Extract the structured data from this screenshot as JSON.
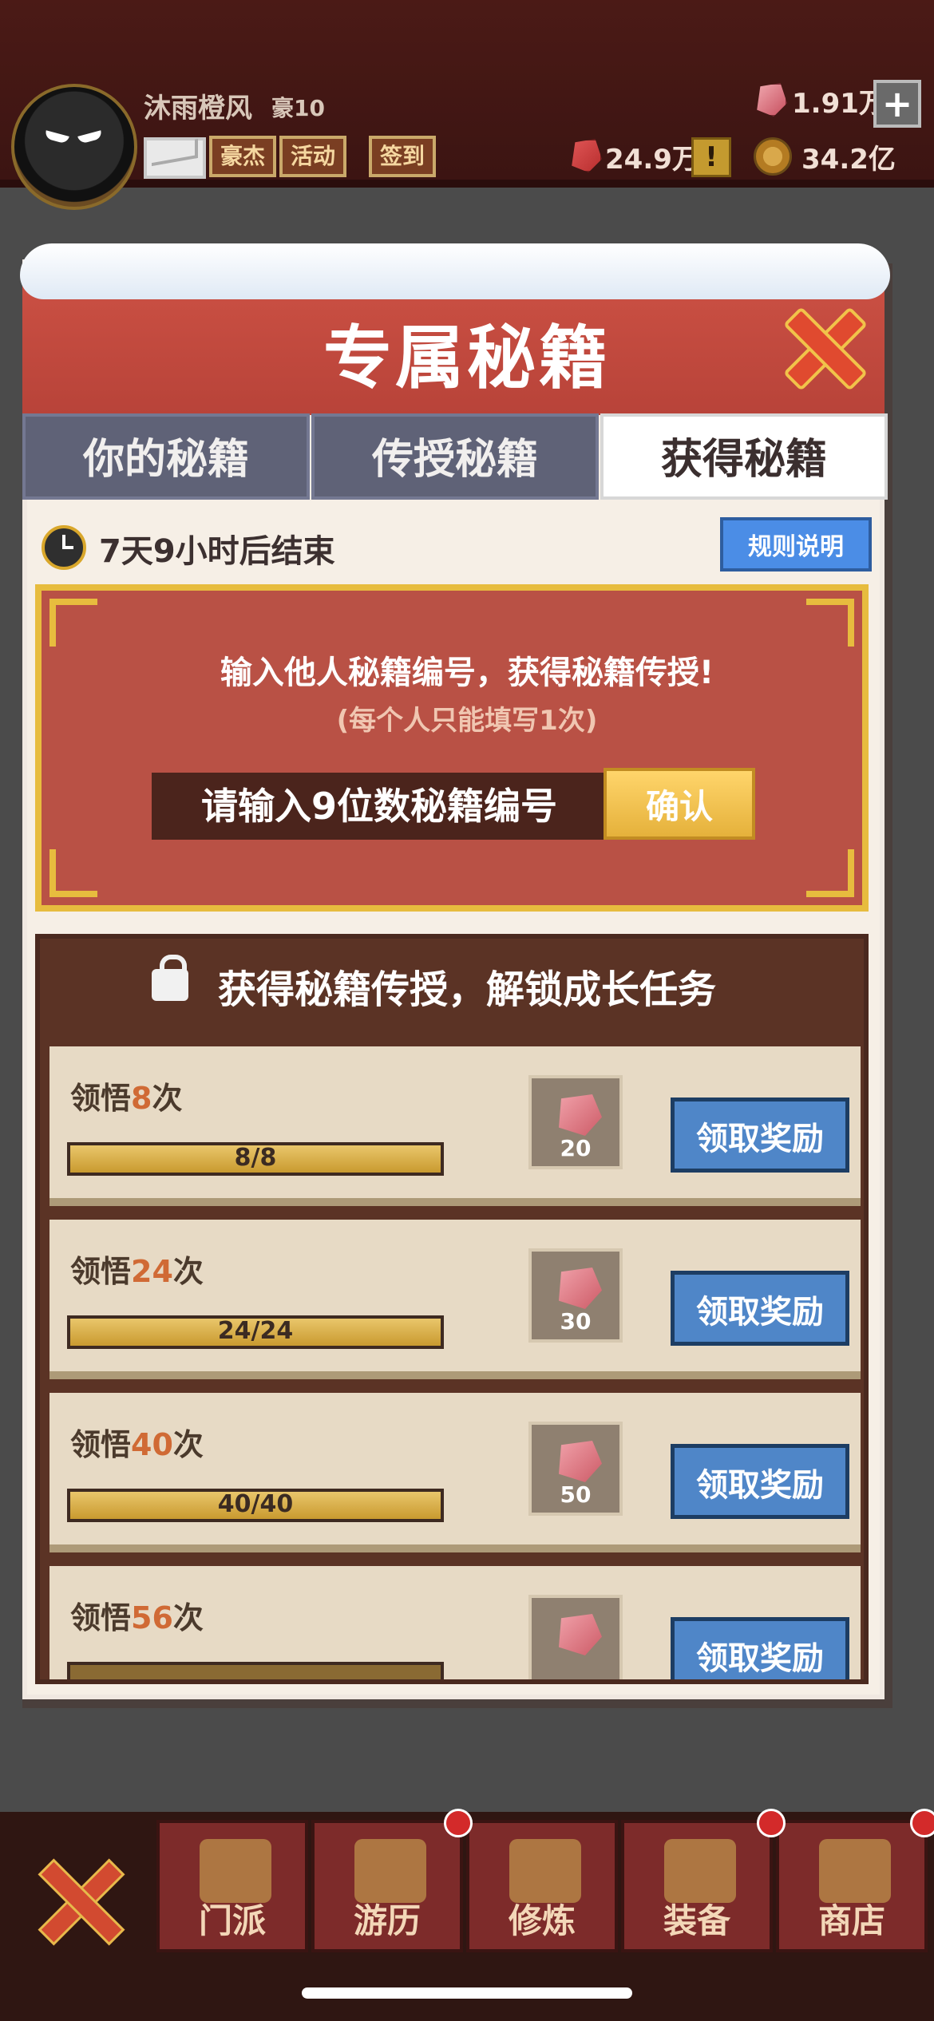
{
  "header": {
    "player_name": "沐雨橙风",
    "rank": "豪10",
    "buttons": [
      {
        "label": "豪杰"
      },
      {
        "label": "活动"
      },
      {
        "label": "签到"
      }
    ],
    "resources": {
      "gems": "1.91万",
      "red": "24.9万",
      "coins": "34.2亿",
      "excl": "!",
      "plus": "+"
    }
  },
  "modal": {
    "title": "专属秘籍",
    "tabs": [
      {
        "label": "你的秘籍",
        "active": false
      },
      {
        "label": "传授秘籍",
        "active": false
      },
      {
        "label": "获得秘籍",
        "active": true
      }
    ],
    "timer": "7天9小时后结束",
    "rules_button": "规则说明",
    "input_panel": {
      "title": "输入他人秘籍编号，获得秘籍传授!",
      "subtitle": "(每个人只能填写1次)",
      "placeholder": "请输入9位数秘籍编号",
      "confirm": "确认"
    },
    "tasks_header": "获得秘籍传授，解锁成长任务",
    "tasks": [
      {
        "label_prefix": "领悟",
        "count": "8",
        "label_suffix": "次",
        "progress_text": "8/8",
        "progress": 1.0,
        "reward_qty": "20",
        "claim_label": "领取奖励"
      },
      {
        "label_prefix": "领悟",
        "count": "24",
        "label_suffix": "次",
        "progress_text": "24/24",
        "progress": 1.0,
        "reward_qty": "30",
        "claim_label": "领取奖励"
      },
      {
        "label_prefix": "领悟",
        "count": "40",
        "label_suffix": "次",
        "progress_text": "40/40",
        "progress": 1.0,
        "reward_qty": "50",
        "claim_label": "领取奖励"
      },
      {
        "label_prefix": "领悟",
        "count": "56",
        "label_suffix": "次",
        "progress_text": "",
        "progress": 0.0,
        "reward_qty": "",
        "claim_label": "领取奖励"
      }
    ]
  },
  "bottom_nav": [
    {
      "label": "门派"
    },
    {
      "label": "游历"
    },
    {
      "label": "修炼"
    },
    {
      "label": "装备"
    },
    {
      "label": "商店"
    }
  ]
}
